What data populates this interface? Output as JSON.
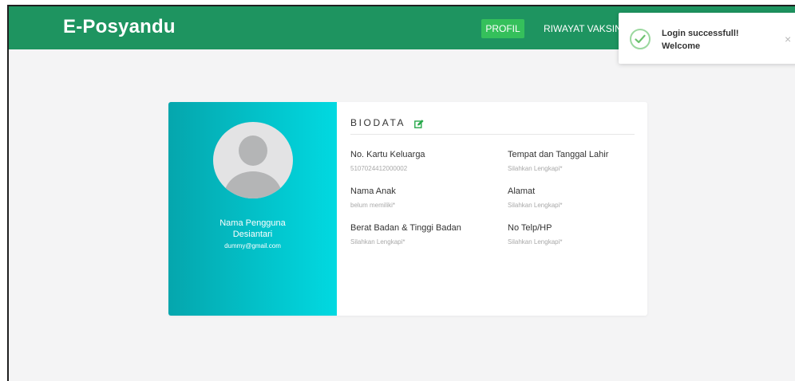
{
  "navbar": {
    "brand": "E-Posyandu",
    "items": [
      {
        "label": "PROFIL",
        "active": true
      },
      {
        "label": "RIWAYAT VAKSIN ..."
      }
    ],
    "bg_color": "#1e9460",
    "active_color": "#35c05b"
  },
  "toast": {
    "icon": "check-circle-icon",
    "title": "Login successfull!",
    "message": "Welcome",
    "close": "×"
  },
  "profile": {
    "avatar_icon": "user-avatar-icon",
    "label": "Nama Pengguna",
    "name": "Desiantari",
    "email": "dummy@gmail.com",
    "gradient": [
      "#05a6ad",
      "#01d9e1"
    ]
  },
  "biodata": {
    "title": "BIODATA",
    "edit_icon": "edit-icon",
    "fields": [
      {
        "label": "No. Kartu Keluarga",
        "value": "5107024412000002"
      },
      {
        "label": "Tempat dan Tanggal Lahir",
        "value": "Silahkan Lengkapi*"
      },
      {
        "label": "Nama Anak",
        "value": "belum memiliki*"
      },
      {
        "label": "Alamat",
        "value": "Silahkan Lengkapi*"
      },
      {
        "label": "Berat Badan & Tinggi Badan",
        "value": "Silahkan Lengkapi*"
      },
      {
        "label": "No Telp/HP",
        "value": "Silahkan Lengkapi*"
      }
    ]
  }
}
